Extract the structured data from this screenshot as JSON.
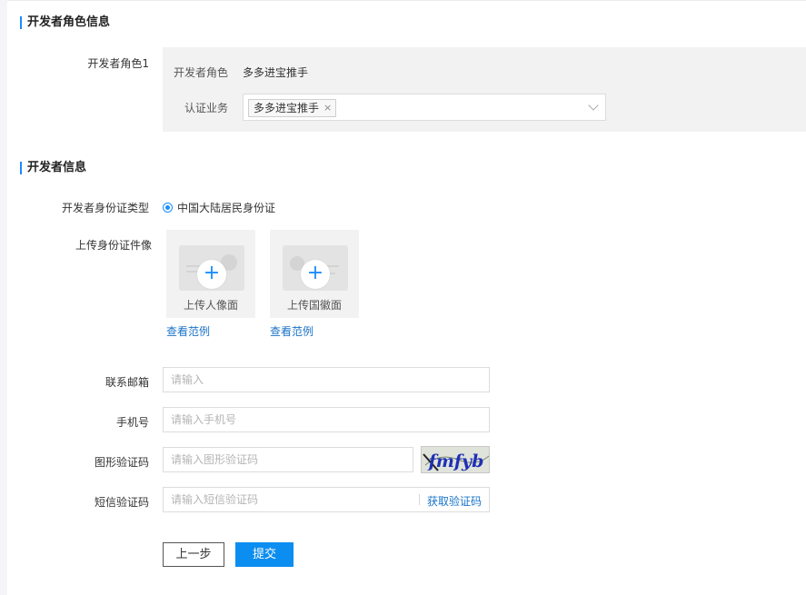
{
  "role_section": {
    "title": "开发者角色信息",
    "role_label": "开发者角色1",
    "role_key": "开发者角色",
    "role_value": "多多进宝推手",
    "cert_key": "认证业务",
    "cert_tag": "多多进宝推手",
    "cert_tag_remove": "×"
  },
  "dev_section": {
    "title": "开发者信息",
    "id_type_label": "开发者身份证类型",
    "id_type_option": "中国大陆居民身份证",
    "upload_label": "上传身份证件像",
    "upload_front": "上传人像面",
    "upload_back": "上传国徽面",
    "view_example_1": "查看范例",
    "view_example_2": "查看范例",
    "plus_glyph": "+",
    "email_label": "联系邮箱",
    "email_placeholder": "请输入",
    "phone_label": "手机号",
    "phone_placeholder": "请输入手机号",
    "captcha_label": "图形验证码",
    "captcha_placeholder": "请输入图形验证码",
    "captcha_text": "fmfyb",
    "sms_label": "短信验证码",
    "sms_placeholder": "请输入短信验证码",
    "sms_button": "获取验证码"
  },
  "actions": {
    "prev": "上一步",
    "submit": "提交"
  },
  "colors": {
    "accent": "#1a8cff",
    "link": "#1a73c8",
    "submit_bg": "#0c8df0"
  }
}
